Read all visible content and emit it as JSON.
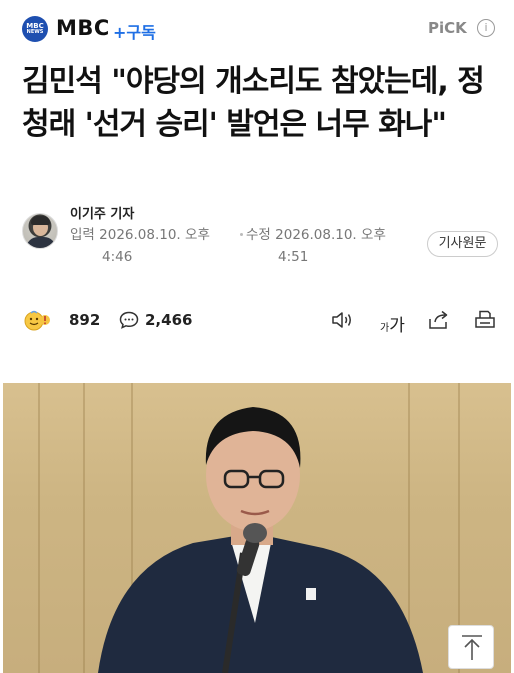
{
  "header": {
    "press_logo_text": "MBC NEWS",
    "press_name": "MBC",
    "subscribe_label": "+구독",
    "pick_label": "PiCK",
    "info_icon": "info-icon"
  },
  "article": {
    "headline": "김민석 \"야당의 개소리도 참았는데, 정청래 '선거 승리' 발언은 너무 화나\"",
    "reporter": "이기주 기자",
    "published_label": "입력",
    "published_date": "2026.08.10. 오후",
    "published_time": "4:46",
    "modified_label": "수정",
    "modified_date": "2026.08.10. 오후",
    "modified_time": "4:51",
    "original_button": "기사원문"
  },
  "actions": {
    "reaction_count": "892",
    "comment_count": "2,466",
    "font_size_label": "가가"
  },
  "colors": {
    "subscribe": "#1f6fe5",
    "logo_bg": "#1e4fb0"
  }
}
